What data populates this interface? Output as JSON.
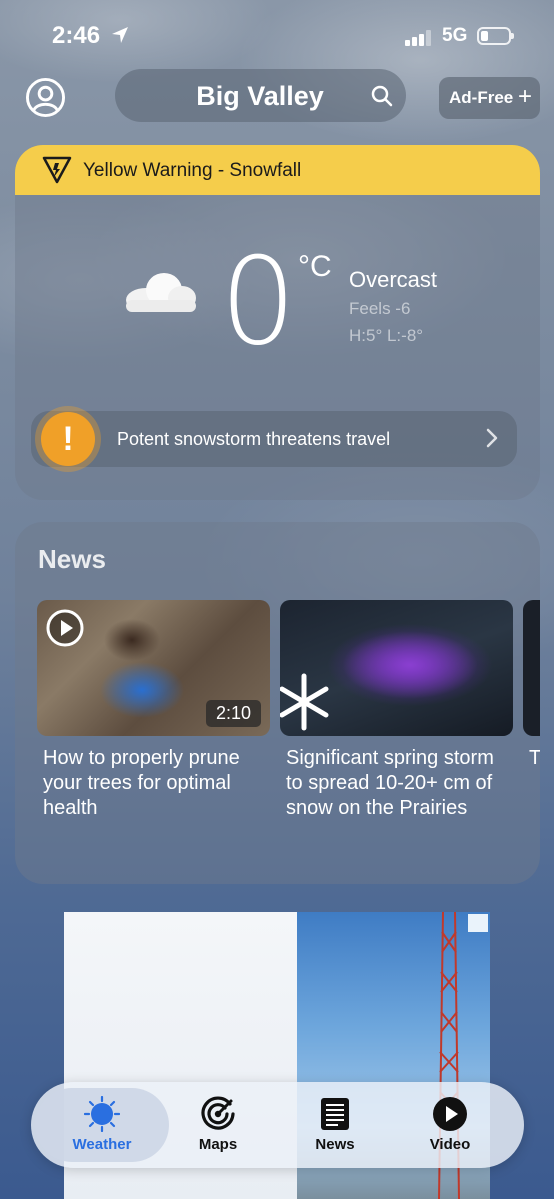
{
  "status_bar": {
    "time": "2:46",
    "network": "5G"
  },
  "header": {
    "city": "Big Valley",
    "ad_free_label": "Ad-Free"
  },
  "warning": {
    "text": "Yellow Warning - Snowfall",
    "color": "#f5cd4b"
  },
  "current": {
    "temperature": "0",
    "unit": "°C",
    "condition": "Overcast",
    "feels_like": "Feels -6",
    "high_low": "H:5° L:-8°"
  },
  "alert": {
    "text": "Potent snowstorm threatens travel",
    "color": "#f0a028"
  },
  "news": {
    "title": "News",
    "items": [
      {
        "headline": "How to properly prune your trees for optimal health",
        "duration": "2:10"
      },
      {
        "headline": "Significant spring storm to spread 10-20+ cm of snow on the Prairies"
      },
      {
        "headline": "T T h"
      }
    ]
  },
  "tabs": [
    {
      "label": "Weather",
      "icon": "sun-icon",
      "active": true
    },
    {
      "label": "Maps",
      "icon": "radar-icon",
      "active": false
    },
    {
      "label": "News",
      "icon": "newspaper-icon",
      "active": false
    },
    {
      "label": "Video",
      "icon": "play-circle-icon",
      "active": false
    }
  ],
  "colors": {
    "accent": "#2a6fe0",
    "warning": "#f5cd4b",
    "alert_badge": "#f0a028"
  }
}
